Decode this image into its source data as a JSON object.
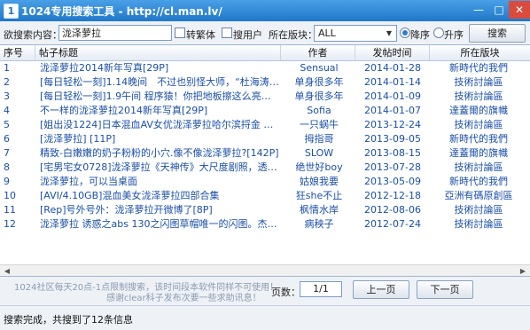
{
  "window": {
    "title": "1024专用搜索工具 - http://cl.man.lv/",
    "icon": "app-icon",
    "minimize": "—",
    "maximize": "□",
    "close": "✕"
  },
  "search": {
    "label": "欲搜索内容：",
    "value": "泷泽萝拉",
    "opt_traditional": "转繁体",
    "opt_user": "搜用户",
    "board_label": "所在版块：",
    "board_value": "ALL",
    "sort_desc": "降序",
    "sort_asc": "升序",
    "sort_selected": "降序",
    "button": "搜索"
  },
  "table": {
    "columns": [
      "序号",
      "帖子标题",
      "作者",
      "发帖时间",
      "所在版块"
    ],
    "rows": [
      {
        "idx": "1",
        "title": "泷泽萝拉2014新年写真[29P]",
        "author": "Sensual",
        "date": "2014-01-28",
        "board": "新時代的我們"
      },
      {
        "idx": "2",
        "title": "[每日轻松一刻]1.14晚间　不过也别怪大师，“杜海涛…",
        "author": "单身很多年",
        "date": "2014-01-14",
        "board": "技術討論區"
      },
      {
        "idx": "3",
        "title": "[每日轻松一刻]1.9午间 程序猿！你把地板擦这么亮…",
        "author": "单身很多年",
        "date": "2014-01-09",
        "board": "技術討論區"
      },
      {
        "idx": "4",
        "title": "不一样的泷泽萝拉2014新年写真[29P]",
        "author": "Sofia",
        "date": "2014-01-07",
        "board": "達蓋爾的旗幟"
      },
      {
        "idx": "5",
        "title": "[姐出没1224]日本混血AV女优泷泽萝拉哈尔滨捋金 俯…",
        "author": "一只蜗牛",
        "date": "2013-12-24",
        "board": "技術討論區"
      },
      {
        "idx": "6",
        "title": "[泷泽萝拉] [11P]",
        "author": "拇指哥",
        "date": "2013-09-05",
        "board": "新時代的我們"
      },
      {
        "idx": "7",
        "title": "精致-白嫩嫩的奶子粉粉的小穴.像不像泷泽萝拉?[142P]",
        "author": "SLOW",
        "date": "2013-08-15",
        "board": "達蓋爾的旗幟"
      },
      {
        "idx": "8",
        "title": "[宅男宅女0728]泷泽萝拉《天神传》大尺度剧照，透视…",
        "author": "绝世好boy",
        "date": "2013-07-28",
        "board": "技術討論區"
      },
      {
        "idx": "9",
        "title": "泷泽萝拉，可以当桌面",
        "author": "姑娘我要",
        "date": "2013-05-09",
        "board": "新時代的我們"
      },
      {
        "idx": "10",
        "title": "[AVI/4.10GB]混血美女泷泽萝拉四部合集",
        "author": "狂she不止",
        "date": "2012-12-18",
        "board": "亞洲有碼原創區"
      },
      {
        "idx": "11",
        "title": "[Rep]号外号外：泷泽萝拉开微博了[8P]",
        "author": "枫情水岸",
        "date": "2012-08-06",
        "board": "技術討論區"
      },
      {
        "idx": "12",
        "title": "泷泽萝拉 诱惑之abs 130之闪图草帽唯一的闪图。杰夫…",
        "author": "病秧子",
        "date": "2012-07-24",
        "board": "技術討論區"
      }
    ]
  },
  "notes": {
    "line1": "1024社区每天20点-1点限制搜索，该时间段本软件同样不可使用！",
    "line2": "感谢clear科子发布次要一些求助讯息！"
  },
  "pager": {
    "label": "页数：",
    "value": "1/1",
    "prev": "上一页",
    "next": "下一页"
  },
  "status": "搜索完成，共搜到了12条信息",
  "scroll": {
    "left": "◀",
    "right": "▶"
  },
  "colors": {
    "titlebar": "#2a86d8",
    "link_text": "#1a4fa8",
    "window_bg": "#eef2f7"
  }
}
